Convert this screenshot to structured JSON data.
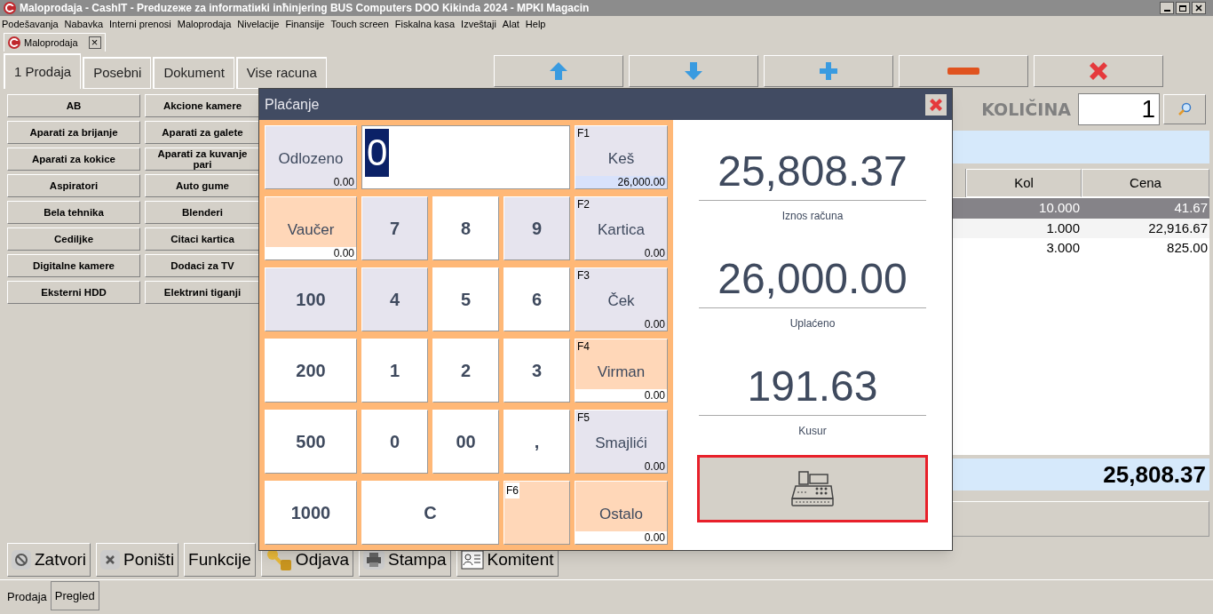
{
  "window": {
    "title": "Maloprodaja - CashIT - Preduzeжe za informatiиki inћinjering BUS Computers DOO Kikinda 2024 - MPKI Magacin"
  },
  "menu": [
    "Podešavanja",
    "Nabavka",
    "Interni prenosi",
    "Maloprodaja",
    "Nivelacije",
    "Finansije",
    "Touch screen",
    "Fiskalna kasa",
    "Izveštaji",
    "Alat",
    "Help"
  ],
  "document_tab": {
    "label": "Maloprodaja",
    "close": "×"
  },
  "tabs": [
    {
      "label": "1 Prodaja",
      "selected": true
    },
    {
      "label": "Posebni",
      "selected": false
    },
    {
      "label": "Dokument",
      "selected": false
    },
    {
      "label": "Vise racuna",
      "selected": false
    }
  ],
  "categories": [
    "AB",
    "Akcione kamere",
    "Aparati za brijanje",
    "Aparati za galete",
    "Aparati za kokice",
    "Aparati za kuvanje pari",
    "Aspiratori",
    "Auto gume",
    "Bela tehnika",
    "Blenderi",
    "Cediljke",
    "Citaci kartica",
    "Digitalne kamere",
    "Dodaci za TV",
    "Eksterni HDD",
    "Elektrиni tiganji"
  ],
  "toolbar": [
    {
      "kind": "up"
    },
    {
      "kind": "down"
    },
    {
      "kind": "plus"
    },
    {
      "kind": "minus"
    },
    {
      "kind": "delete"
    }
  ],
  "quantity": {
    "label": "KOLIČINA",
    "value": "1"
  },
  "table": {
    "columns": [
      "Kol",
      "Cena"
    ],
    "rows": [
      {
        "cells": [
          "10.000",
          "41.67"
        ],
        "selected": true
      },
      {
        "cells": [
          "1.000",
          "22,916.67"
        ],
        "selected": false
      },
      {
        "cells": [
          "3.000",
          "825.00"
        ],
        "selected": false
      }
    ]
  },
  "total": "25,808.37",
  "bottom_buttons": [
    {
      "label": "Zatvori",
      "kind": "cancel"
    },
    {
      "label": "Poništi",
      "kind": "x"
    },
    {
      "label": "Funkcije",
      "kind": "none"
    },
    {
      "label": "Odjava",
      "kind": "keys"
    },
    {
      "label": "Stampa",
      "kind": "print"
    },
    {
      "label": "Komitent",
      "kind": "person"
    }
  ],
  "bottom_tabs": [
    {
      "label": "Prodaja",
      "selected": true
    },
    {
      "label": "Pregled",
      "selected": false
    }
  ],
  "dialog": {
    "title": "Plaćanje",
    "keypad": [
      {
        "kind": "payment",
        "name": "Odlozeno",
        "amount": "0.00",
        "color": "#e6e4ee",
        "selected": false
      },
      {
        "kind": "entry",
        "value": "0"
      },
      {
        "kind": "payment",
        "fkey": "F1",
        "name": "Keš",
        "amount": "26,000.00",
        "color": "#e6e4ee",
        "selected": true
      },
      {
        "kind": "payment",
        "name": "Vaučer",
        "amount": "0.00",
        "color": "#ffd7b8",
        "selected": false
      },
      {
        "kind": "key",
        "label": "7",
        "color": "#e6e4ee"
      },
      {
        "kind": "key",
        "label": "8",
        "color": "#ffffff"
      },
      {
        "kind": "key",
        "label": "9",
        "color": "#e6e4ee"
      },
      {
        "kind": "payment",
        "fkey": "F2",
        "name": "Kartica",
        "amount": "0.00",
        "color": "#e6e4ee",
        "selected": false
      },
      {
        "kind": "key",
        "label": "100",
        "color": "#e6e4ee"
      },
      {
        "kind": "key",
        "label": "4",
        "color": "#e6e4ee"
      },
      {
        "kind": "key",
        "label": "5",
        "color": "#ffffff"
      },
      {
        "kind": "key",
        "label": "6",
        "color": "#ffffff"
      },
      {
        "kind": "payment",
        "fkey": "F3",
        "name": "Ček",
        "amount": "0.00",
        "color": "#e6e4ee",
        "selected": false
      },
      {
        "kind": "key",
        "label": "200",
        "color": "#ffffff"
      },
      {
        "kind": "key",
        "label": "1",
        "color": "#ffffff"
      },
      {
        "kind": "key",
        "label": "2",
        "color": "#ffffff"
      },
      {
        "kind": "key",
        "label": "3",
        "color": "#ffffff"
      },
      {
        "kind": "payment",
        "fkey": "F4",
        "name": "Virman",
        "amount": "0.00",
        "color": "#ffd7b8",
        "selected": false
      },
      {
        "kind": "key",
        "label": "500",
        "color": "#ffffff"
      },
      {
        "kind": "key",
        "label": "0",
        "color": "#ffffff"
      },
      {
        "kind": "key",
        "label": "00",
        "color": "#ffffff"
      },
      {
        "kind": "key",
        "label": ",",
        "color": "#ffffff"
      },
      {
        "kind": "payment",
        "fkey": "F5",
        "name": "Smajlići",
        "amount": "0.00",
        "color": "#e6e4ee",
        "selected": false
      },
      {
        "kind": "key",
        "label": "1000",
        "color": "#ffffff"
      },
      {
        "kind": "wide-key",
        "label": "C",
        "color": "#ffffff"
      },
      {
        "kind": "empty-payment",
        "fkey": "F6",
        "color": "#ffd7b8"
      },
      {
        "kind": "payment",
        "name": "Ostalo",
        "amount": "0.00",
        "color": "#ffd7b8",
        "selected": false
      }
    ],
    "summary": [
      {
        "value": "25,808.37",
        "label": "Iznos računa"
      },
      {
        "value": "26,000.00",
        "label": "Uplaćeno"
      },
      {
        "value": "191.63",
        "label": "Kusur"
      }
    ],
    "fiscal_button": {
      "focused": true
    }
  }
}
